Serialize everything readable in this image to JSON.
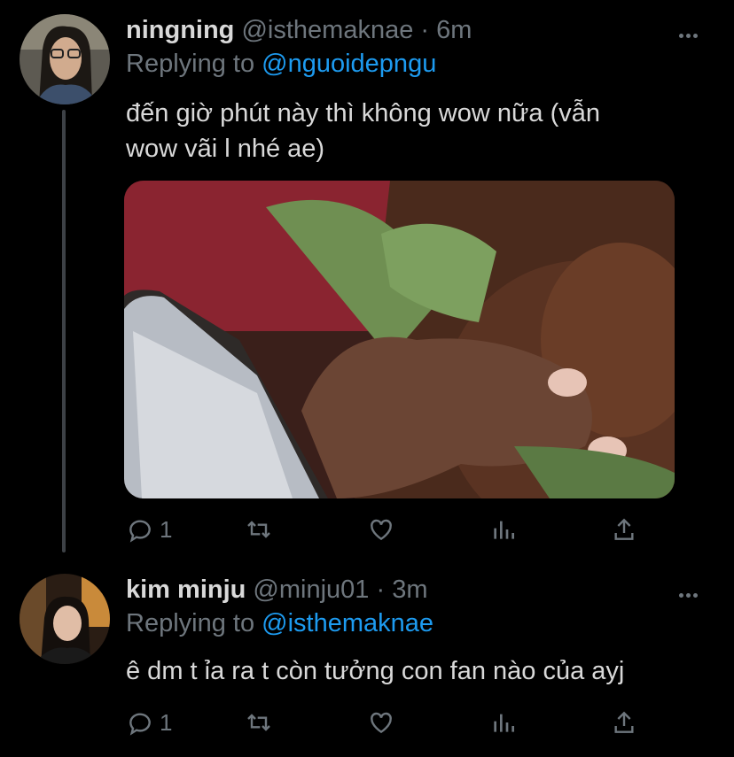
{
  "tweets": [
    {
      "name": "ningning",
      "handle": "@isthemaknae",
      "separator": "·",
      "time": "6m",
      "replying_prefix": "Replying to",
      "replying_to": "@nguoidepngu",
      "text_line1": "đến giờ phút này thì không wow nữa (vẫn",
      "text_line2": "wow vãi l nhé ae)",
      "reply_count": "1",
      "has_media": true
    },
    {
      "name": "kim minju",
      "handle": "@minju01",
      "separator": "·",
      "time": "3m",
      "replying_prefix": "Replying to",
      "replying_to": "@isthemaknae",
      "text_line1": "ê dm t ỉa ra t còn tưởng con fan nào của ayj",
      "reply_count": "1",
      "has_media": false
    }
  ],
  "icons": [
    "more-icon",
    "reply-icon",
    "retweet-icon",
    "like-icon",
    "analytics-icon",
    "share-icon"
  ],
  "colors": {
    "background": "#000000",
    "link": "#1d9bf0",
    "muted": "#6e767d",
    "text": "#d9d9d9"
  }
}
